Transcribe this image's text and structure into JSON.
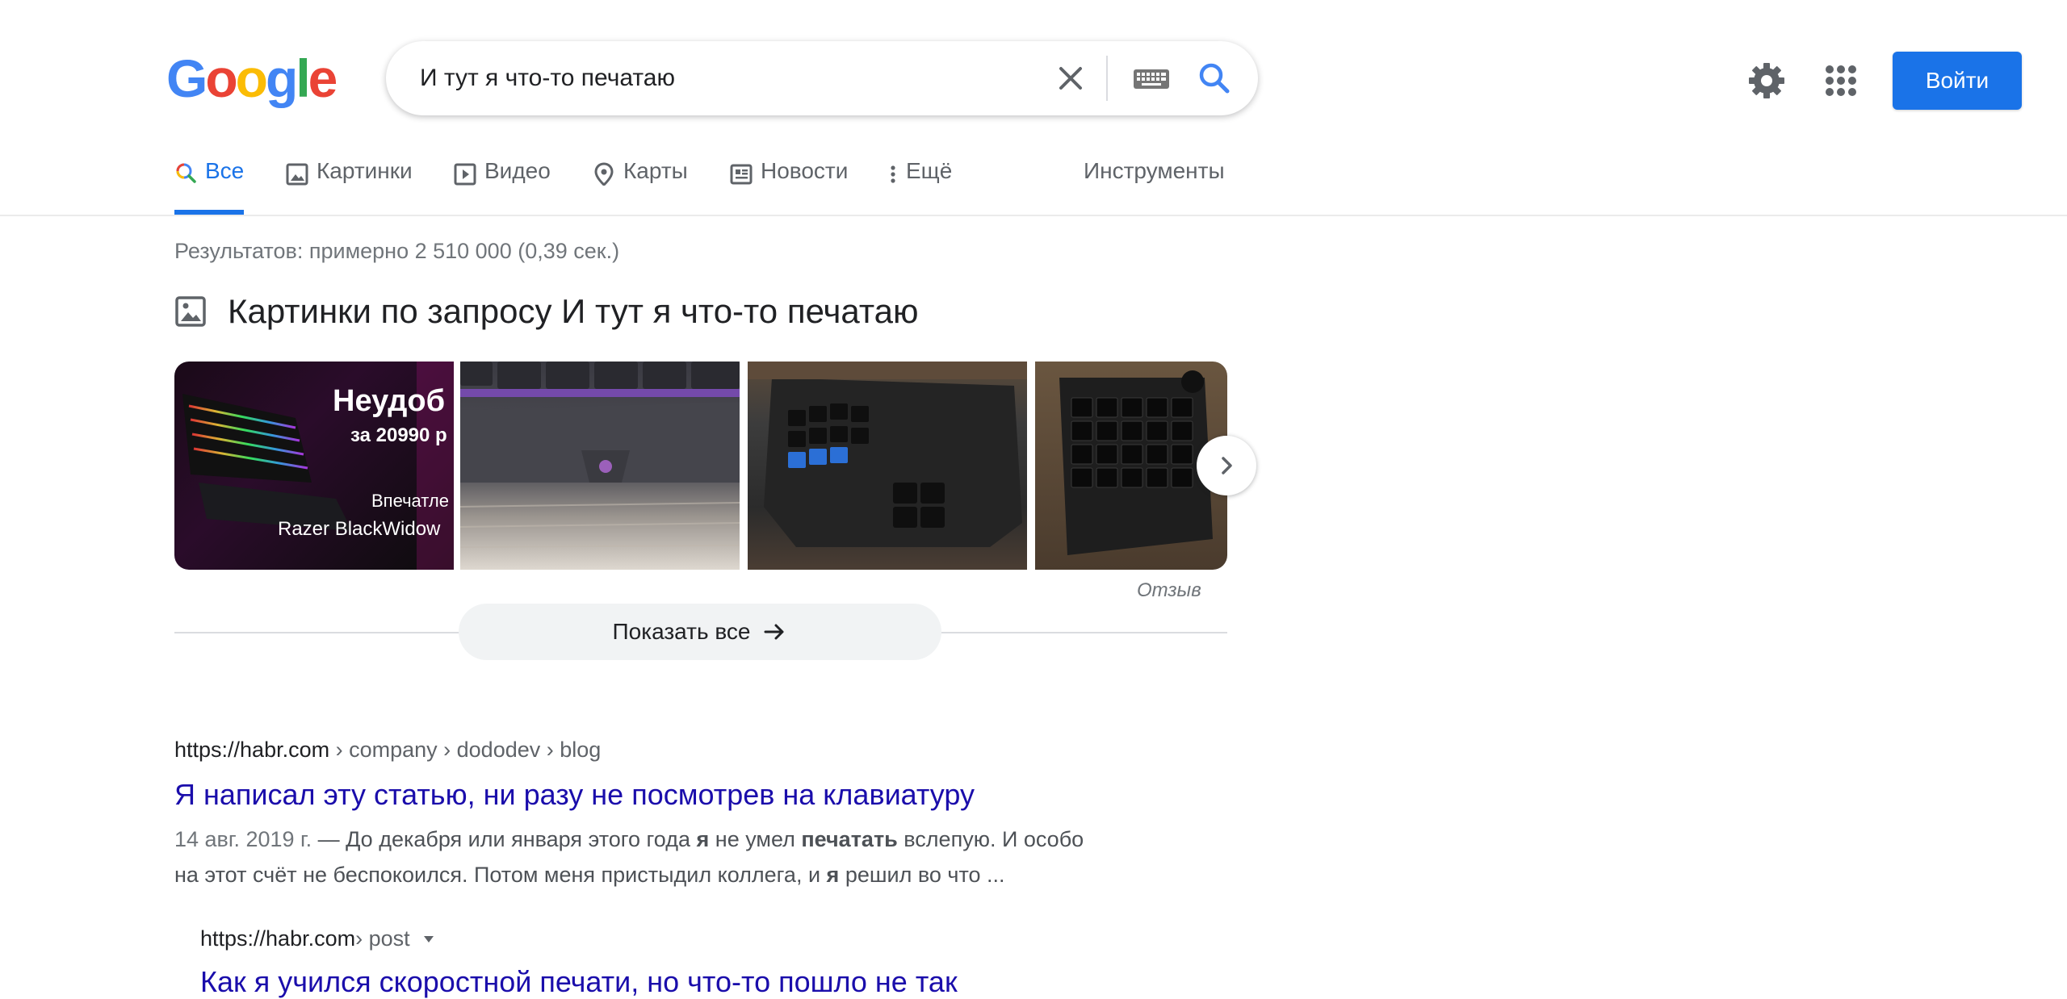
{
  "header": {
    "logo_text": "Google",
    "search": {
      "value": "И тут я что-то печатаю"
    },
    "signin_label": "Войти"
  },
  "tabs": [
    {
      "label": "Все",
      "icon": "search-icon",
      "active": true
    },
    {
      "label": "Картинки",
      "icon": "image-icon"
    },
    {
      "label": "Видео",
      "icon": "play-icon"
    },
    {
      "label": "Карты",
      "icon": "map-pin-icon"
    },
    {
      "label": "Новости",
      "icon": "news-icon"
    },
    {
      "label": "Ещё",
      "icon": "more-vert-icon"
    }
  ],
  "tools_label": "Инструменты",
  "result_stats": "Результатов: примерно 2 510 000 (0,39 сек.)",
  "images_block": {
    "heading": "Картинки по запросу И тут я что-то печатаю",
    "thumb1": {
      "headline": "Неудоб",
      "price": "за 20990 р",
      "subline": "Впечатле",
      "model": "Razer BlackWidow"
    },
    "feedback": "Отзыв",
    "show_all": "Показать все"
  },
  "results": [
    {
      "url_host": "https://habr.com",
      "url_path": " › company › dododev › blog",
      "title": "Я написал эту статью, ни разу не посмотрев на клавиатуру",
      "date": "14 авг. 2019 г.",
      "snippet_line1_a": " — До декабря или января этого года ",
      "snippet_line1_b": "я",
      "snippet_line1_c": " не умел ",
      "snippet_line1_d": "печатать",
      "snippet_line1_e": " вслепую. И особо",
      "snippet_line2_a": "на этот счёт не беспокоился. Потом меня пристыдил коллега, и ",
      "snippet_line2_b": "я",
      "snippet_line2_c": " решил во что ..."
    },
    {
      "url_host": "https://habr.com",
      "url_path": " › post",
      "title": "Как я учился скоростной печати, но что-то пошло не так"
    }
  ],
  "colors": {
    "accent": "#1a73e8",
    "link": "#1a0dab",
    "secondary_text": "#5f6368"
  }
}
